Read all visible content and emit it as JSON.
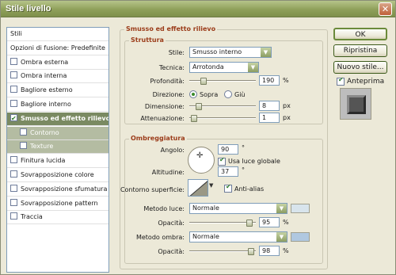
{
  "window": {
    "title": "Stile livello",
    "close_label": "✕"
  },
  "left_panel": {
    "items": [
      {
        "label": "Stili",
        "checkbox": false,
        "checked": false,
        "state": "header"
      },
      {
        "label": "Opzioni di fusione: Predefinite",
        "checkbox": false,
        "checked": false,
        "state": "normal"
      },
      {
        "label": "Ombra esterna",
        "checkbox": true,
        "checked": false,
        "state": "normal"
      },
      {
        "label": "Ombra interna",
        "checkbox": true,
        "checked": false,
        "state": "normal"
      },
      {
        "label": "Bagliore esterno",
        "checkbox": true,
        "checked": false,
        "state": "normal"
      },
      {
        "label": "Bagliore interno",
        "checkbox": true,
        "checked": false,
        "state": "normal"
      },
      {
        "label": "Smusso ed effetto rilievo",
        "checkbox": true,
        "checked": true,
        "state": "selected"
      },
      {
        "label": "Contorno",
        "checkbox": true,
        "checked": false,
        "state": "sub"
      },
      {
        "label": "Texture",
        "checkbox": true,
        "checked": false,
        "state": "sub"
      },
      {
        "label": "Finitura lucida",
        "checkbox": true,
        "checked": false,
        "state": "normal"
      },
      {
        "label": "Sovrapposizione colore",
        "checkbox": true,
        "checked": false,
        "state": "normal"
      },
      {
        "label": "Sovrapposizione sfumatura",
        "checkbox": true,
        "checked": false,
        "state": "normal"
      },
      {
        "label": "Sovrapposizione pattern",
        "checkbox": true,
        "checked": false,
        "state": "normal"
      },
      {
        "label": "Traccia",
        "checkbox": true,
        "checked": false,
        "state": "normal"
      }
    ]
  },
  "bevel": {
    "section_title": "Smusso ed effetto rilievo",
    "struttura": {
      "title": "Struttura",
      "stile_label": "Stile:",
      "stile_value": "Smusso interno",
      "tecnica_label": "Tecnica:",
      "tecnica_value": "Arrotonda",
      "profondita_label": "Profondità:",
      "profondita_value": "190",
      "profondita_unit": "%",
      "profondita_level": 0.19,
      "direzione_label": "Direzione:",
      "direzione_up": "Sopra",
      "direzione_down": "Giù",
      "dimensione_label": "Dimensione:",
      "dimensione_value": "8",
      "dimensione_unit": "px",
      "dimensione_level": 0.1,
      "attenuazione_label": "Attenuazione:",
      "attenuazione_value": "1",
      "attenuazione_unit": "px",
      "attenuazione_level": 0.02
    },
    "ombreggiatura": {
      "title": "Ombreggiatura",
      "angolo_label": "Angolo:",
      "angolo_value": "90",
      "angolo_unit": "°",
      "luce_globale_label": "Usa luce globale",
      "altitudine_label": "Altitudine:",
      "altitudine_value": "37",
      "altitudine_unit": "°",
      "contorno_label": "Contorno superficie:",
      "antialias_label": "Anti-alias",
      "metodo_luce_label": "Metodo luce:",
      "metodo_luce_value": "Normale",
      "opacita_luce_label": "Opacità:",
      "opacita_luce_value": "95",
      "opacita_luce_unit": "%",
      "opacita_luce_level": 0.95,
      "metodo_ombra_label": "Metodo ombra:",
      "metodo_ombra_value": "Normale",
      "opacita_ombra_label": "Opacità:",
      "opacita_ombra_value": "98",
      "opacita_ombra_unit": "%",
      "opacita_ombra_level": 0.98
    }
  },
  "buttons": {
    "ok": "OK",
    "ripristina": "Ripristina",
    "nuovo_stile": "Nuovo stile...",
    "anteprima": "Anteprima"
  },
  "colors": {
    "highlight_swatch": "#d8e4ec",
    "shadow_swatch": "#b0c8e0",
    "accent": "#7a8a62",
    "title_text": "#9b3c1a"
  }
}
